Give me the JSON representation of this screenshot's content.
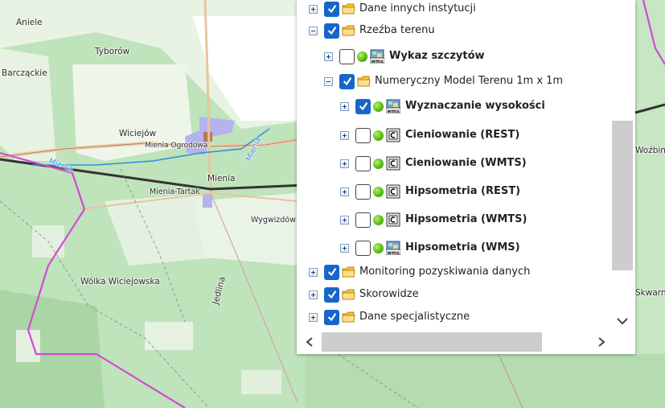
{
  "map": {
    "labels": {
      "aniele": "Aniele",
      "tyborow": "Tyborów",
      "barczackie": "Barcząckie",
      "wieciejow": "Wiciejów",
      "mienia_ogrodowa": "Mienia Ogrodowa",
      "mienia": "Mienia",
      "mienia_river_1": "Mienia",
      "mienia_river_2": "Mienia",
      "mienia_tartak": "Mienia-Tartak",
      "wygwizdow": "Wygwizdów",
      "wolka": "Wólka Wiciejowska",
      "jedlina": "Jedlina",
      "wozbin": "Woźbin",
      "skwarn": "Skwarn"
    }
  },
  "layer_tree": {
    "rows": [
      {
        "label": "Dane innych instytucji",
        "expanded": false,
        "checked": true,
        "type": "folder",
        "bold": false
      },
      {
        "label": "Rzeźba terenu",
        "expanded": true,
        "checked": true,
        "type": "folder",
        "bold": false
      },
      {
        "label": "Wykaz szczytów",
        "expanded": false,
        "checked": false,
        "type": "wms",
        "bold": true
      },
      {
        "label": "Numeryczny Model Terenu 1m x 1m",
        "expanded": true,
        "checked": true,
        "type": "folder",
        "bold": false
      },
      {
        "label": "Wyznaczanie wysokości",
        "expanded": false,
        "checked": true,
        "type": "wms",
        "bold": true
      },
      {
        "label": "Cieniowanie (REST)",
        "expanded": false,
        "checked": false,
        "type": "rest",
        "bold": true
      },
      {
        "label": "Cieniowanie (WMTS)",
        "expanded": false,
        "checked": false,
        "type": "rest",
        "bold": true
      },
      {
        "label": "Hipsometria (REST)",
        "expanded": false,
        "checked": false,
        "type": "rest",
        "bold": true
      },
      {
        "label": "Hipsometria (WMTS)",
        "expanded": false,
        "checked": false,
        "type": "rest",
        "bold": true
      },
      {
        "label": "Hipsometria (WMS)",
        "expanded": false,
        "checked": false,
        "type": "wms",
        "bold": true
      },
      {
        "label": "Monitoring pozyskiwania danych",
        "expanded": false,
        "checked": true,
        "type": "folder",
        "bold": false
      },
      {
        "label": "Skorowidze",
        "expanded": false,
        "checked": true,
        "type": "folder",
        "bold": false
      },
      {
        "label": "Dane specjalistyczne",
        "expanded": false,
        "checked": true,
        "type": "folder",
        "bold": false
      }
    ]
  },
  "colors": {
    "checkbox_on": "#1766c9",
    "status_dot": "#4fb90f",
    "folder": "#f5c242"
  }
}
